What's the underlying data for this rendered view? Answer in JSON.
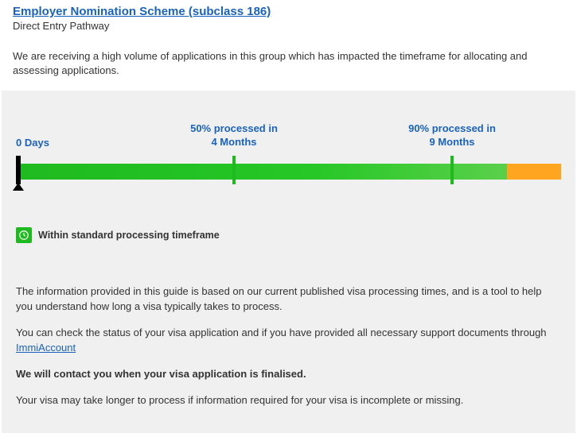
{
  "header": {
    "title": "Employer Nomination Scheme (subclass 186)",
    "subtitle": "Direct Entry Pathway"
  },
  "notice": "We are receiving a high volume of applications in this group which has impacted the timeframe for allocating and assessing applications.",
  "timeline": {
    "start_label": "0 Days",
    "p50_line1": "50% processed in",
    "p50_line2": "4 Months",
    "p90_line1": "90% processed in",
    "p90_line2": "9 Months",
    "p50_pos_pct": 40,
    "p90_pos_pct": 80,
    "green_fill_pct": 90,
    "status_text": "Within standard processing timeframe"
  },
  "info": {
    "para1": "The information provided in this guide is based on our current published visa processing times, and is a tool to help you understand how long a visa typically takes to process.",
    "para2a": "You can check the status of your visa application and if you have provided all necessary support documents through ",
    "para2_link": "ImmiAccount",
    "para3": "We will contact you when your visa application is finalised.",
    "para4": "Your visa may take longer to process if information required for your visa is incomplete or missing."
  },
  "chart_data": {
    "type": "bar",
    "title": "Processing time distribution",
    "series": [
      {
        "name": "50% processed",
        "value": 4,
        "unit": "Months"
      },
      {
        "name": "90% processed",
        "value": 9,
        "unit": "Months"
      }
    ],
    "origin": {
      "label": "0 Days",
      "value": 0
    }
  }
}
